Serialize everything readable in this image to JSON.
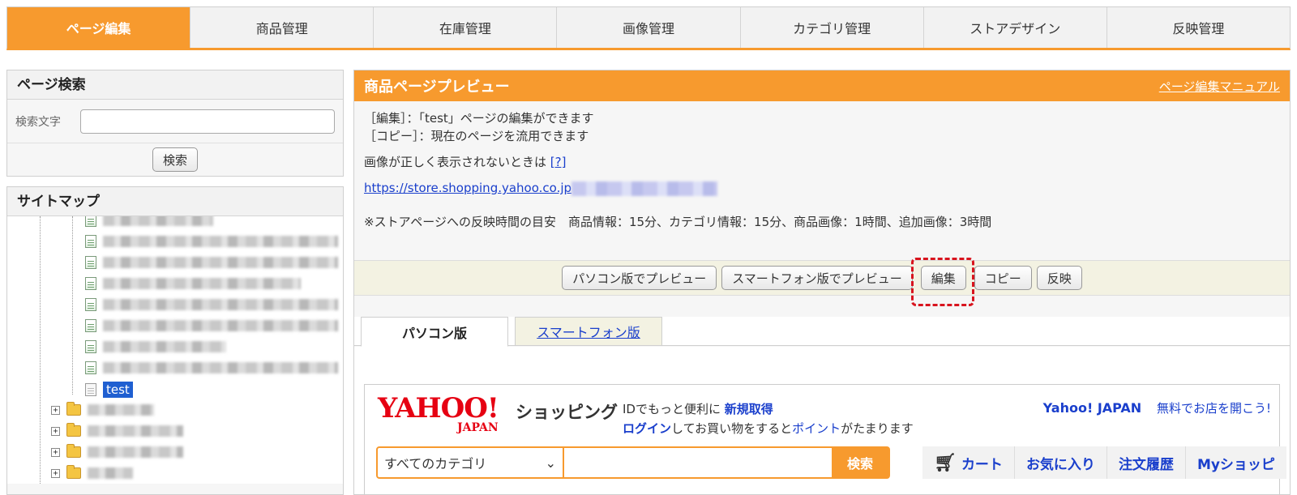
{
  "top_nav": {
    "tabs": [
      "ページ編集",
      "商品管理",
      "在庫管理",
      "画像管理",
      "カテゴリ管理",
      "ストアデザイン",
      "反映管理"
    ]
  },
  "page_search": {
    "title": "ページ検索",
    "label": "検索文字",
    "input_value": "",
    "button": "検索"
  },
  "sitemap": {
    "title": "サイトマップ",
    "selected_item": "test"
  },
  "preview": {
    "title": "商品ページプレビュー",
    "manual_link": "ページ編集マニュアル",
    "line1": "［編集］：「test」ページの編集ができます",
    "line2": "［コピー］：現在のページを流用できます",
    "image_help": "画像が正しく表示されないときは",
    "help_link": "[?]",
    "url": "https://store.shopping.yahoo.co.jp",
    "reflect_note": "※ストアページへの反映時間の目安　商品情報：15分、カテゴリ情報：15分、商品画像：1時間、追加画像：3時間",
    "buttons": {
      "pc_preview": "パソコン版でプレビュー",
      "sp_preview": "スマートフォン版でプレビュー",
      "edit": "編集",
      "copy": "コピー",
      "reflect": "反映"
    },
    "view_tabs": {
      "pc": "パソコン版",
      "sp": "スマートフォン版"
    }
  },
  "yahoo_header": {
    "logo_main": "YAHOO!",
    "logo_sub": "JAPAN",
    "shopping": "ショッピング",
    "id_text": "IDでもっと便利に",
    "register": "新規取得",
    "login": "ログイン",
    "login_rest": "してお買い物をすると",
    "point": "ポイント",
    "point_rest": "がたまります",
    "yahoo_japan": "Yahoo! JAPAN",
    "open_store": "無料でお店を開こう!",
    "category_select": "すべてのカテゴリ",
    "search_button": "検索",
    "links": {
      "cart": "カート",
      "favorites": "お気に入り",
      "history": "注文履歴",
      "my": "Myショッピ"
    }
  },
  "colors": {
    "accent": "#f79a2e",
    "link": "#1a3fcc",
    "highlight": "#d8141e"
  }
}
